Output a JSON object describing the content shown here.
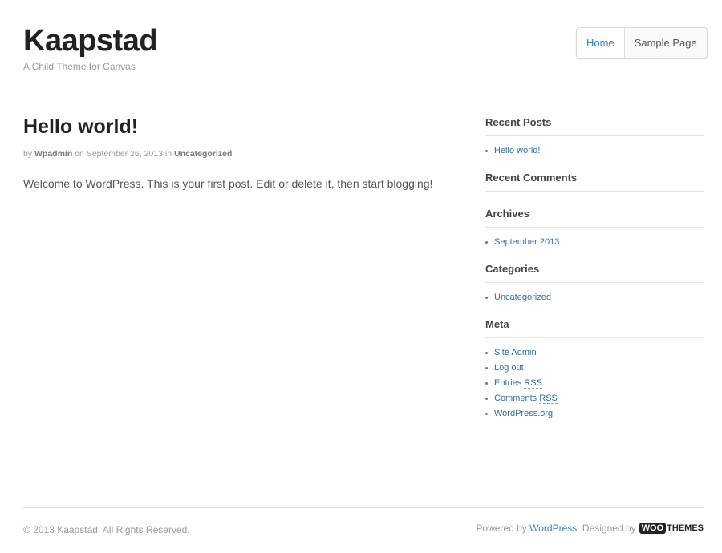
{
  "site": {
    "title": "Kaapstad",
    "description": "A Child Theme for Canvas"
  },
  "nav": {
    "items": [
      "Home",
      "Sample Page"
    ],
    "active": "Home"
  },
  "post": {
    "title": "Hello world!",
    "meta_by": "by",
    "author": "Wpadmin",
    "meta_on": "on",
    "date": "September 26, 2013",
    "meta_in": "in",
    "category": "Uncategorized",
    "body": "Welcome to WordPress. This is your first post. Edit or delete it, then start blogging!"
  },
  "sidebar": {
    "recent_posts": {
      "title": "Recent Posts",
      "items": [
        "Hello world!"
      ]
    },
    "recent_comments": {
      "title": "Recent Comments"
    },
    "archives": {
      "title": "Archives",
      "items": [
        "September 2013"
      ]
    },
    "categories": {
      "title": "Categories",
      "items": [
        "Uncategorized"
      ]
    },
    "meta": {
      "title": "Meta",
      "site_admin": "Site Admin",
      "log_out": "Log out",
      "entries_prefix": "Entries ",
      "entries_abbr": "RSS",
      "comments_prefix": "Comments ",
      "comments_abbr": "RSS",
      "wordpress_org": "WordPress.org"
    }
  },
  "footer": {
    "copyright": "© 2013 Kaapstad. All Rights Reserved.",
    "powered_by": "Powered by",
    "wordpress": "WordPress",
    "designed_by": ". Designed by",
    "woo_box": "WOO",
    "woo_text": "THEMES"
  },
  "colors": {
    "link": "#2e84c6",
    "title": "#222222",
    "muted": "#999999"
  }
}
